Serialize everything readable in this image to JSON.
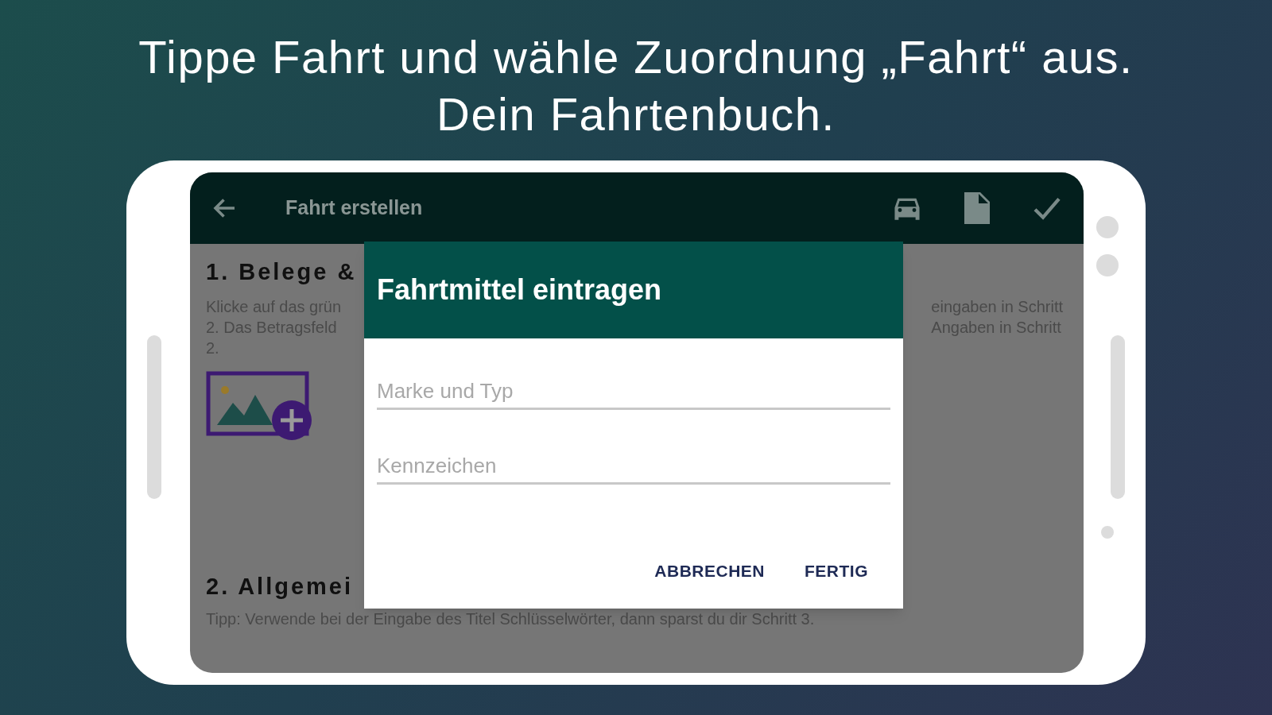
{
  "headline": [
    "Tippe Fahrt und wähle Zuordnung „Fahrt“ aus.",
    "Dein Fahrtenbuch."
  ],
  "app_bar": {
    "title": "Fahrt erstellen"
  },
  "sections": [
    {
      "heading": "1. Belege &",
      "left_lines": [
        "Klicke auf das grün",
        "2. Das Betragsfeld",
        "2."
      ],
      "right_lines": [
        "eingaben in Schritt",
        "Angaben in Schritt"
      ]
    },
    {
      "heading": "2. Allgemei",
      "tip": "Tipp: Verwende bei der Eingabe des Titel Schlüsselwörter, dann sparst du dir Schritt 3."
    }
  ],
  "dialog": {
    "title": "Fahrtmittel eintragen",
    "fields": [
      {
        "placeholder": "Marke und Typ"
      },
      {
        "placeholder": "Kennzeichen"
      }
    ],
    "buttons": [
      "ABBRECHEN",
      "FERTIG"
    ]
  }
}
